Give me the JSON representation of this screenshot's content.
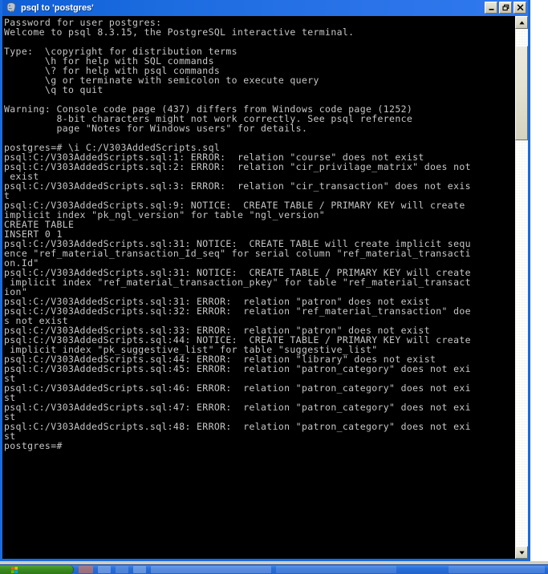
{
  "window": {
    "title": "psql to 'postgres'",
    "icon": "postgresql-elephant-icon",
    "controls": {
      "minimize_label": "Minimize",
      "restore_label": "Restore",
      "close_label": "Close"
    },
    "colors": {
      "titlebar_start": "#0f5ed6",
      "titlebar_end": "#2f79ee",
      "console_bg": "#000000",
      "console_fg": "#c6c6c6",
      "taskbar_blue": "#2a6fd8",
      "start_green": "#3d8c23"
    }
  },
  "console": {
    "prompt": "postgres=#",
    "command": "\\i C:/V303AddedScripts.sql",
    "script_path": "C:/V303AddedScripts.sql",
    "psql_version": "8.3.15",
    "console_code_page": "437",
    "windows_code_page": "1252",
    "text": "Password for user postgres:\nWelcome to psql 8.3.15, the PostgreSQL interactive terminal.\n\nType:  \\copyright for distribution terms\n       \\h for help with SQL commands\n       \\? for help with psql commands\n       \\g or terminate with semicolon to execute query\n       \\q to quit\n\nWarning: Console code page (437) differs from Windows code page (1252)\n         8-bit characters might not work correctly. See psql reference\n         page \"Notes for Windows users\" for details.\n\npostgres=# \\i C:/V303AddedScripts.sql\npsql:C:/V303AddedScripts.sql:1: ERROR:  relation \"course\" does not exist\npsql:C:/V303AddedScripts.sql:2: ERROR:  relation \"cir_privilage_matrix\" does not\n exist\npsql:C:/V303AddedScripts.sql:3: ERROR:  relation \"cir_transaction\" does not exis\nt\npsql:C:/V303AddedScripts.sql:9: NOTICE:  CREATE TABLE / PRIMARY KEY will create\nimplicit index \"pk_ngl_version\" for table \"ngl_version\"\nCREATE TABLE\nINSERT 0 1\npsql:C:/V303AddedScripts.sql:31: NOTICE:  CREATE TABLE will create implicit sequ\nence \"ref_material_transaction_Id_seq\" for serial column \"ref_material_transacti\non.Id\"\npsql:C:/V303AddedScripts.sql:31: NOTICE:  CREATE TABLE / PRIMARY KEY will create\n implicit index \"ref_material_transaction_pkey\" for table \"ref_material_transact\nion\"\npsql:C:/V303AddedScripts.sql:31: ERROR:  relation \"patron\" does not exist\npsql:C:/V303AddedScripts.sql:32: ERROR:  relation \"ref_material_transaction\" doe\ns not exist\npsql:C:/V303AddedScripts.sql:33: ERROR:  relation \"patron\" does not exist\npsql:C:/V303AddedScripts.sql:44: NOTICE:  CREATE TABLE / PRIMARY KEY will create\n implicit index \"pk_suggestive_list\" for table \"suggestive_list\"\npsql:C:/V303AddedScripts.sql:44: ERROR:  relation \"library\" does not exist\npsql:C:/V303AddedScripts.sql:45: ERROR:  relation \"patron_category\" does not exi\nst\npsql:C:/V303AddedScripts.sql:46: ERROR:  relation \"patron_category\" does not exi\nst\npsql:C:/V303AddedScripts.sql:47: ERROR:  relation \"patron_category\" does not exi\nst\npsql:C:/V303AddedScripts.sql:48: ERROR:  relation \"patron_category\" does not exi\nst\npostgres=#"
  },
  "scrollbar": {
    "up_arrow": "scroll-up-arrow",
    "down_arrow": "scroll-down-arrow",
    "thumb": "scroll-thumb"
  },
  "taskbar": {
    "start_label": "start",
    "items": []
  }
}
